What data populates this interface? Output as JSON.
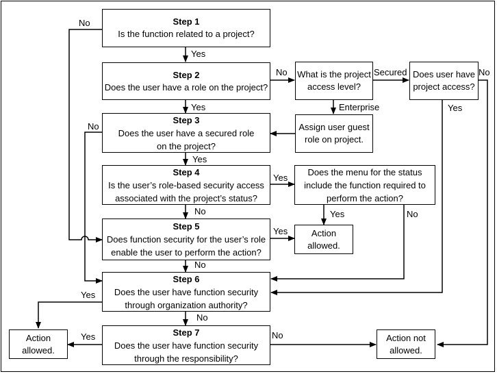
{
  "diagram": {
    "steps": [
      {
        "title": "Step 1",
        "question": "Is the function related to a project?"
      },
      {
        "title": "Step 2",
        "question": "Does the user have a role on the project?"
      },
      {
        "title": "Step 3",
        "question": "Does the user have a secured role on the project?"
      },
      {
        "title": "Step 4",
        "question": "Is the user’s role-based security access associated with the project’s status?"
      },
      {
        "title": "Step 5",
        "question": "Does function security for the user’s role enable the user to perform the action?"
      },
      {
        "title": "Step 6",
        "question": "Does the user have function security through organization authority?"
      },
      {
        "title": "Step 7",
        "question": "Does the user have function security through the responsibility?"
      }
    ],
    "side_boxes": {
      "access_level": "What is the project access level?",
      "project_access": "Does user have project access?",
      "assign_guest": "Assign user guest role on project.",
      "menu_status": "Does the menu for the status include the function required to perform the action?",
      "allowed_mid": "Action allowed.",
      "allowed_left": "Action allowed.",
      "not_allowed": "Action not allowed."
    },
    "edge_labels": {
      "s1_no": "No",
      "s1_yes": "Yes",
      "s2_yes": "Yes",
      "s2_no": "No",
      "secured": "Secured",
      "enterprise": "Enterprise",
      "pa_no": "No",
      "pa_yes": "Yes",
      "s3_no": "No",
      "s3_yes": "Yes",
      "s4_yes": "Yes",
      "s4_no": "No",
      "menu_yes": "Yes",
      "menu_no": "No",
      "s5_yes": "Yes",
      "s5_no": "No",
      "s6_yes": "Yes",
      "s6_no": "No",
      "s7_yes": "Yes",
      "s7_no": "No"
    }
  }
}
